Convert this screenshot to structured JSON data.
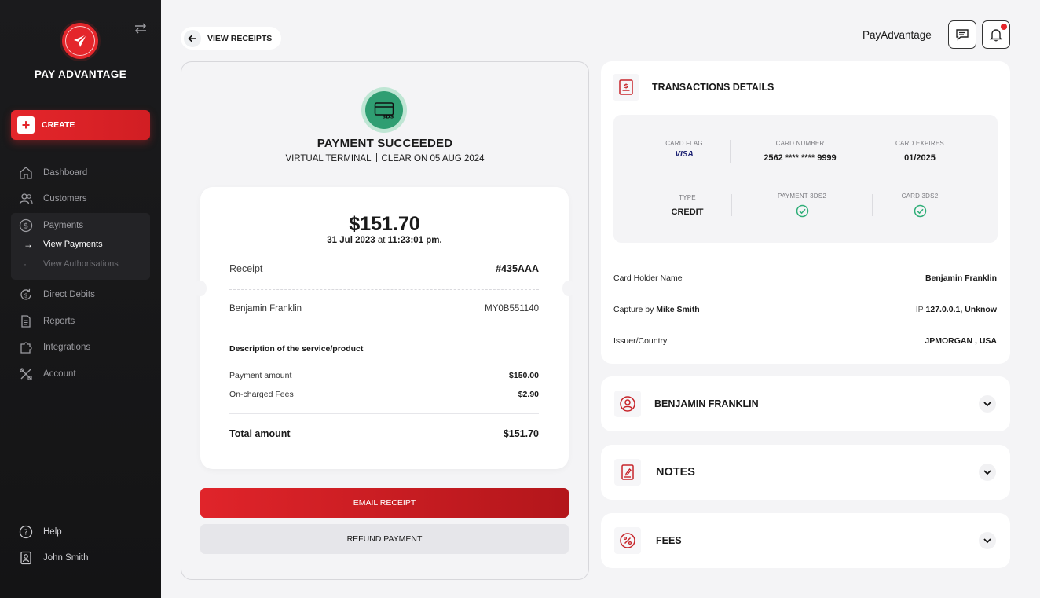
{
  "brand": {
    "name": "PAY ADVANTAGE",
    "logo_icon": "paper-plane-icon",
    "accent": "#e4262b"
  },
  "sidebar": {
    "create_label": "CREATE",
    "items": [
      {
        "label": "Dashboard",
        "icon": "home-icon"
      },
      {
        "label": "Customers",
        "icon": "users-icon"
      },
      {
        "label": "Payments",
        "icon": "dollar-circle-icon"
      },
      {
        "label": "Direct Debits",
        "icon": "refresh-dollar-icon"
      },
      {
        "label": "Reports",
        "icon": "document-icon"
      },
      {
        "label": "Integrations",
        "icon": "puzzle-icon"
      },
      {
        "label": "Account",
        "icon": "tools-icon"
      }
    ],
    "payments_sub": [
      {
        "label": "View Payments",
        "active": true
      },
      {
        "label": "View Authorisations",
        "active": false
      }
    ],
    "footer": [
      {
        "label": "Help",
        "icon": "help-icon"
      },
      {
        "label": "John Smith",
        "icon": "user-badge-icon"
      }
    ]
  },
  "topbar": {
    "back_label": "VIEW RECEIPTS",
    "brand_text": "PayAdvantage"
  },
  "receipt": {
    "status_title": "PAYMENT SUCCEEDED",
    "terminal": "VIRTUAL TERMINAL",
    "clear_text": "CLEAR ON 05 AUG 2024",
    "amount": "$151.70",
    "date": "31 Jul 2023",
    "at_word": "at",
    "time": "11:23:01 pm.",
    "receipt_label": "Receipt",
    "receipt_number": "#435AAA",
    "customer_name": "Benjamin Franklin",
    "customer_ref": "MY0B551140",
    "description_label": "Description of the service/product",
    "payment_amount_label": "Payment amount",
    "payment_amount": "$150.00",
    "fees_label": "On-charged Fees",
    "fees": "$2.90",
    "total_label": "Total amount",
    "total": "$151.70",
    "email_button": "EMAIL RECEIPT",
    "refund_button": "REFUND PAYMENT"
  },
  "transaction": {
    "title": "TRANSACTIONS DETAILS",
    "card_flag_label": "CARD FLAG",
    "card_flag": "VISA",
    "card_number_label": "CARD NUMBER",
    "card_number": "2562 **** **** 9999",
    "card_expires_label": "CARD EXPIRES",
    "card_expires": "01/2025",
    "type_label": "TYPE",
    "type": "CREDIT",
    "payment_3ds2_label": "PAYMENT 3DS2",
    "card_3ds2_label": "CARD 3DS2",
    "holder_label": "Card Holder Name",
    "holder": "Benjamin Franklin",
    "capture_prefix": "Capture by",
    "capture_name": "Mike Smith",
    "ip_prefix": "IP",
    "ip": "127.0.0.1, Unknow",
    "issuer_label": "Issuer/Country",
    "issuer": "JPMORGAN , USA"
  },
  "sections": [
    {
      "title": "BENJAMIN FRANKLIN",
      "icon": "user-circle-icon"
    },
    {
      "title": "NOTES",
      "icon": "note-edit-icon"
    },
    {
      "title": "FEES",
      "icon": "percent-icon"
    }
  ]
}
